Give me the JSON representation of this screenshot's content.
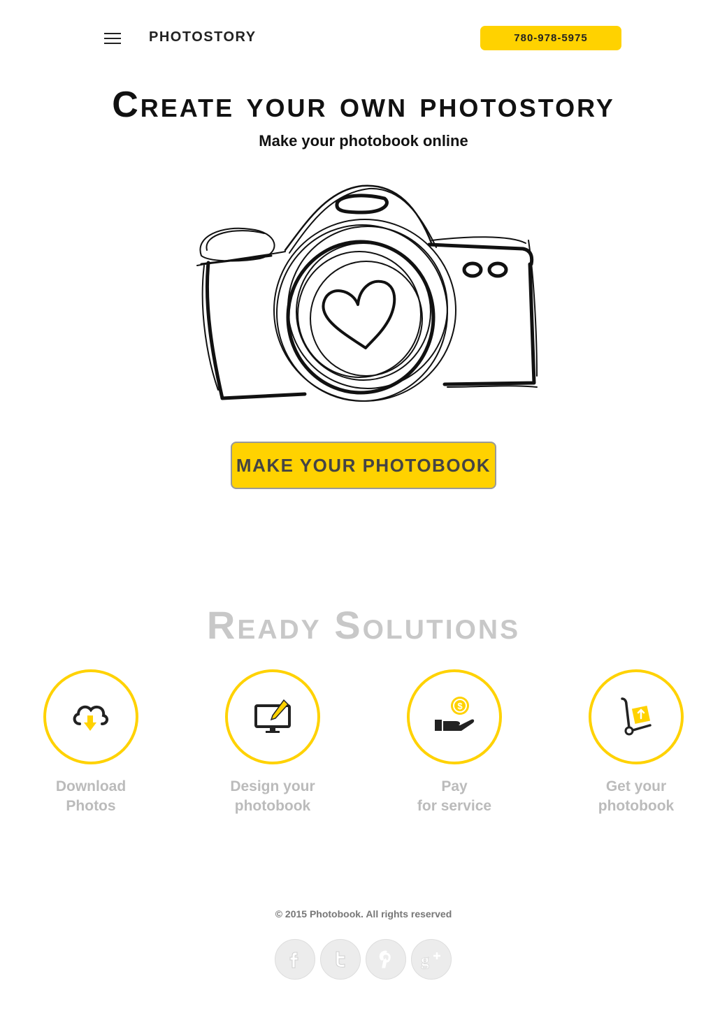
{
  "header": {
    "brand": "PHOTOSTORY",
    "phone": "780-978-5975"
  },
  "hero": {
    "title": "Create your own photostory",
    "subtitle": "Make your photobook online",
    "cta_label": "MAKE YOUR PHOTOBOOK"
  },
  "solutions": {
    "title": "Ready Solutions",
    "steps": [
      {
        "icon": "cloud-download-icon",
        "line1": "Download",
        "line2": "Photos"
      },
      {
        "icon": "monitor-design-icon",
        "line1": "Design your",
        "line2": "photobook"
      },
      {
        "icon": "hand-coin-icon",
        "line1": "Pay",
        "line2": "for service"
      },
      {
        "icon": "hand-truck-icon",
        "line1": "Get your",
        "line2": "photobook"
      }
    ]
  },
  "footer": {
    "copyright": "© 2015 Photobook. All rights reserved",
    "social": [
      "facebook-icon",
      "twitter-icon",
      "pinterest-icon",
      "google-plus-icon"
    ]
  },
  "colors": {
    "accent": "#ffd200",
    "muted": "#bbbbbb"
  }
}
